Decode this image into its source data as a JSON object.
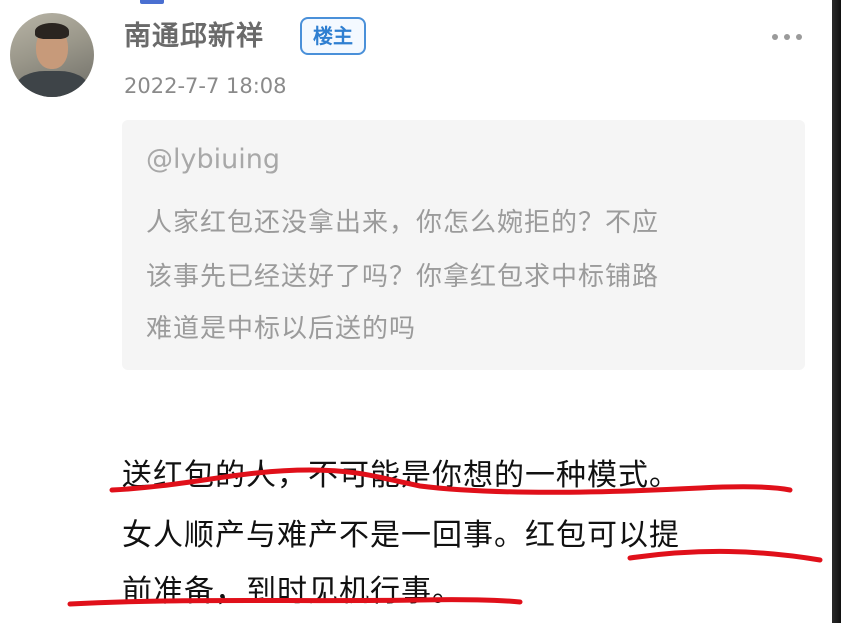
{
  "post": {
    "author": {
      "name": "南通邱新祥",
      "badge": "楼主"
    },
    "timestamp": "2022-7-7 18:08",
    "quote": {
      "mention": "@lybiuing",
      "lines": [
        "人家红包还没拿出来，你怎么婉拒的？不应",
        "该事先已经送好了吗？你拿红包求中标铺路",
        "难道是中标以后送的吗"
      ]
    },
    "reply_lines": [
      "送红包的人，不可能是你想的一种模式。",
      "女人顺产与难产不是一回事。红包可以提",
      "前准备，到时见机行事。"
    ]
  },
  "icons": {
    "more": "more-dots-icon"
  },
  "colors": {
    "badge_border": "#4a90d9",
    "badge_text": "#2f7fd1",
    "annotation_red": "#e0101a",
    "quote_bg": "#f5f5f5"
  }
}
